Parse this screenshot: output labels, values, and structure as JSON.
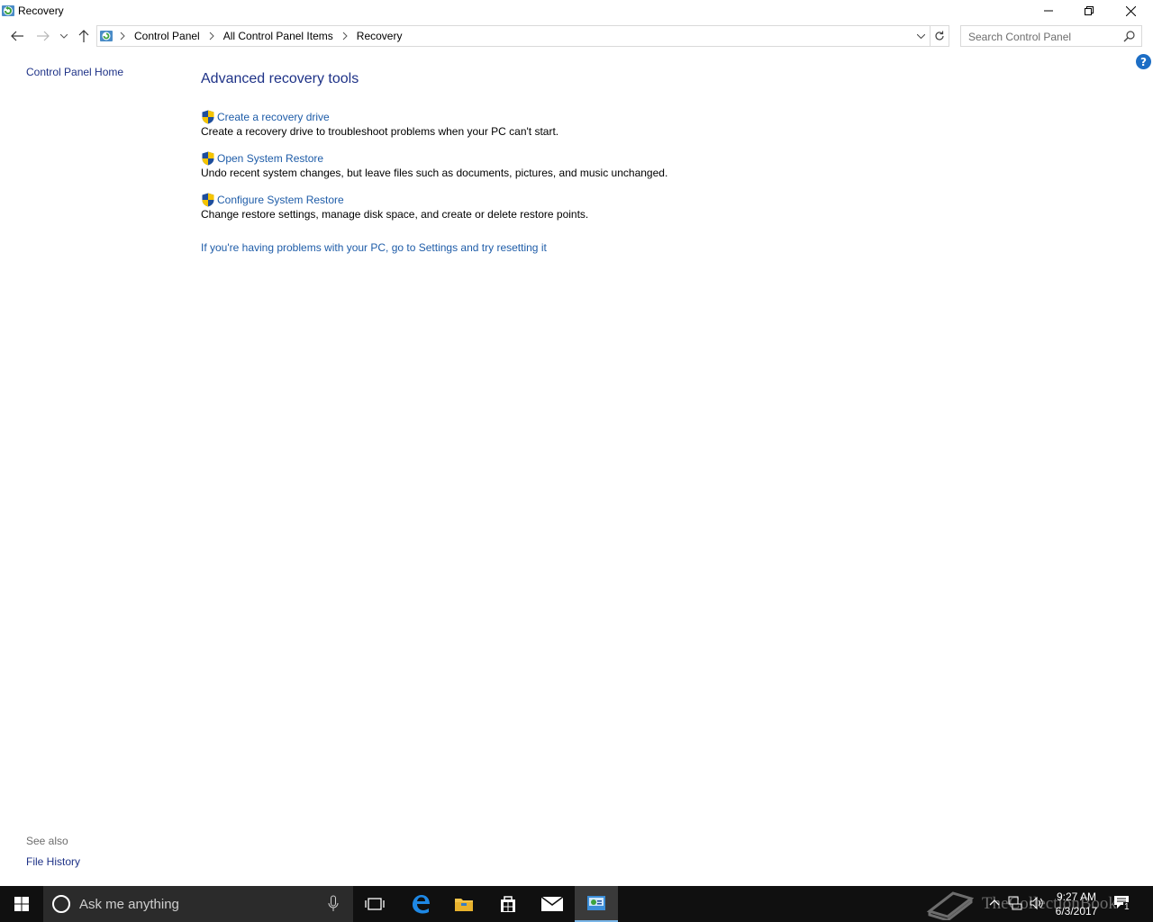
{
  "window": {
    "title": "Recovery"
  },
  "address_bar": {
    "breadcrumbs": [
      "Control Panel",
      "All Control Panel Items",
      "Recovery"
    ]
  },
  "search": {
    "placeholder": "Search Control Panel"
  },
  "left_pane": {
    "home_link": "Control Panel Home",
    "see_also_label": "See also",
    "see_also_links": [
      "File History"
    ]
  },
  "main": {
    "heading": "Advanced recovery tools",
    "tasks": [
      {
        "label": "Create a recovery drive",
        "description": "Create a recovery drive to troubleshoot problems when your PC can't start."
      },
      {
        "label": "Open System Restore",
        "description": "Undo recent system changes, but leave files such as documents, pictures, and music unchanged."
      },
      {
        "label": "Configure System Restore",
        "description": "Change restore settings, manage disk space, and create or delete restore points."
      }
    ],
    "reset_link": "If you're having problems with your PC, go to Settings and try resetting it"
  },
  "help": {
    "symbol": "?"
  },
  "taskbar": {
    "search_placeholder": "Ask me anything",
    "time": "9:27 AM",
    "date": "6/3/2017",
    "watermark": "TheCollectionBook",
    "notification_count": "1",
    "accent_color": "#7ab6e8"
  },
  "colors": {
    "link": "#1e5ca8",
    "heading": "#1e3287",
    "taskbar": "#101010"
  }
}
